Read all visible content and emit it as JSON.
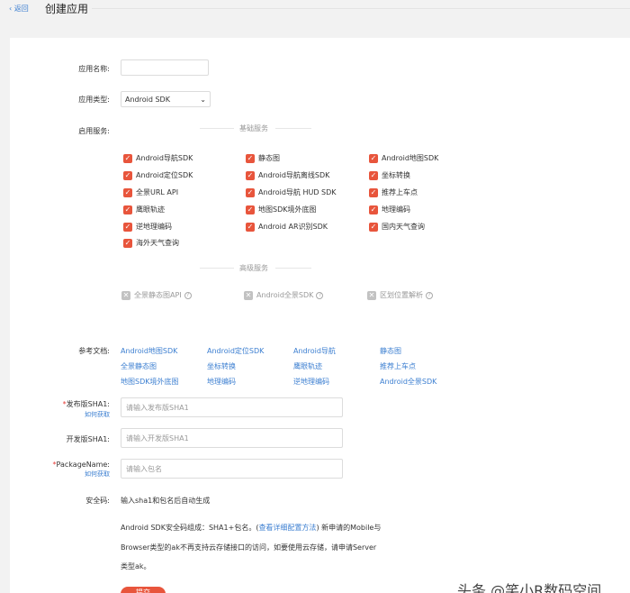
{
  "header": {
    "back_label": "返回",
    "title": "创建应用"
  },
  "form": {
    "app_name_label": "应用名称:",
    "app_name_value": "",
    "app_type_label": "应用类型:",
    "app_type_value": "Android SDK",
    "services_label": "启用服务:",
    "basic_section": "基础服务",
    "basic_services": [
      "Android导航SDK",
      "静态图",
      "Android地图SDK",
      "Android定位SDK",
      "Android导航离线SDK",
      "坐标转换",
      "全景URL API",
      "Android导航 HUD SDK",
      "推荐上车点",
      "鹰眼轨迹",
      "地图SDK境外底图",
      "地理编码",
      "逆地理编码",
      "Android AR识别SDK",
      "国内天气查询",
      "海外天气查询"
    ],
    "advanced_section": "高级服务",
    "advanced_services": [
      "全景静态图API",
      "Android全景SDK",
      "区划位置解析"
    ],
    "docs_label": "参考文档:",
    "docs": [
      "Android地图SDK",
      "Android定位SDK",
      "Android导航",
      "静态图",
      "全景静态图",
      "坐标转换",
      "鹰眼轨迹",
      "推荐上车点",
      "地图SDK境外底图",
      "地理编码",
      "逆地理编码",
      "Android全景SDK"
    ],
    "release_sha1_label": "发布版SHA1:",
    "release_sha1_help": "如何获取",
    "release_sha1_placeholder": "请输入发布版SHA1",
    "dev_sha1_label": "开发版SHA1:",
    "dev_sha1_placeholder": "请输入开发版SHA1",
    "package_label": "PackageName:",
    "package_help": "如何获取",
    "package_placeholder": "请输入包名",
    "security_label": "安全码:",
    "security_value": "输入sha1和包名后自动生成",
    "note_line1_a": "Android SDK安全码组成：SHA1+包名。(",
    "note_link": "查看详细配置方法",
    "note_line1_b": ") 新申请的Mobile与",
    "note_line2": "Browser类型的ak不再支持云存储接口的访问，如要使用云存储，请申请Server",
    "note_line3": "类型ak。",
    "submit_label": "提交"
  },
  "watermark": "头条 @笑小R数码空间"
}
